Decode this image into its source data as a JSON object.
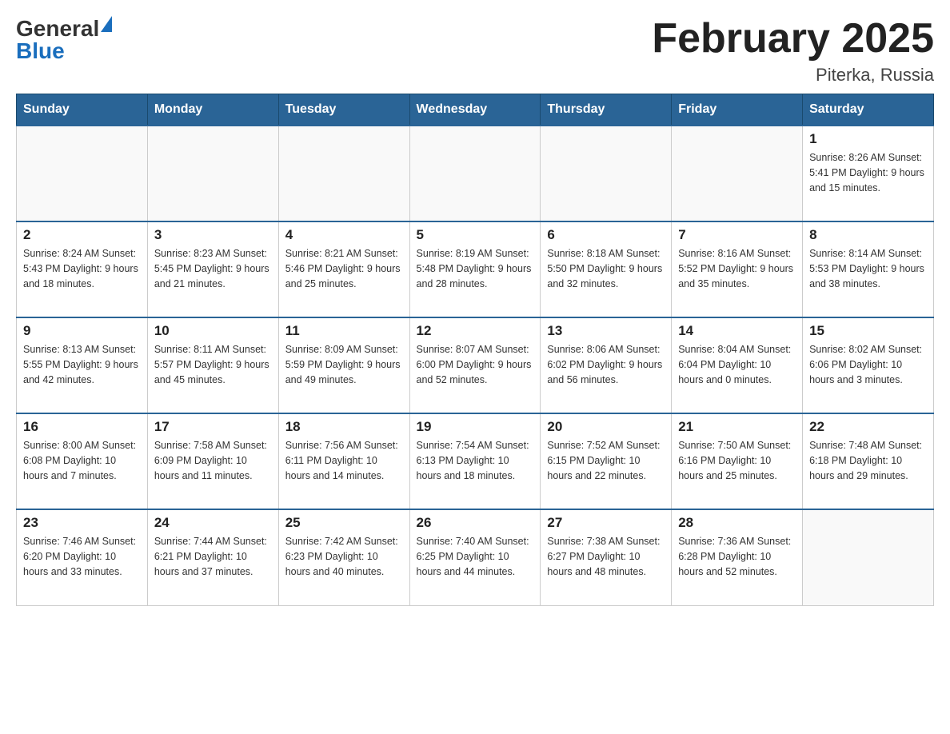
{
  "header": {
    "logo_general": "General",
    "logo_blue": "Blue",
    "month_title": "February 2025",
    "location": "Piterka, Russia"
  },
  "weekdays": [
    "Sunday",
    "Monday",
    "Tuesday",
    "Wednesday",
    "Thursday",
    "Friday",
    "Saturday"
  ],
  "weeks": [
    [
      {
        "day": "",
        "info": ""
      },
      {
        "day": "",
        "info": ""
      },
      {
        "day": "",
        "info": ""
      },
      {
        "day": "",
        "info": ""
      },
      {
        "day": "",
        "info": ""
      },
      {
        "day": "",
        "info": ""
      },
      {
        "day": "1",
        "info": "Sunrise: 8:26 AM\nSunset: 5:41 PM\nDaylight: 9 hours and 15 minutes."
      }
    ],
    [
      {
        "day": "2",
        "info": "Sunrise: 8:24 AM\nSunset: 5:43 PM\nDaylight: 9 hours and 18 minutes."
      },
      {
        "day": "3",
        "info": "Sunrise: 8:23 AM\nSunset: 5:45 PM\nDaylight: 9 hours and 21 minutes."
      },
      {
        "day": "4",
        "info": "Sunrise: 8:21 AM\nSunset: 5:46 PM\nDaylight: 9 hours and 25 minutes."
      },
      {
        "day": "5",
        "info": "Sunrise: 8:19 AM\nSunset: 5:48 PM\nDaylight: 9 hours and 28 minutes."
      },
      {
        "day": "6",
        "info": "Sunrise: 8:18 AM\nSunset: 5:50 PM\nDaylight: 9 hours and 32 minutes."
      },
      {
        "day": "7",
        "info": "Sunrise: 8:16 AM\nSunset: 5:52 PM\nDaylight: 9 hours and 35 minutes."
      },
      {
        "day": "8",
        "info": "Sunrise: 8:14 AM\nSunset: 5:53 PM\nDaylight: 9 hours and 38 minutes."
      }
    ],
    [
      {
        "day": "9",
        "info": "Sunrise: 8:13 AM\nSunset: 5:55 PM\nDaylight: 9 hours and 42 minutes."
      },
      {
        "day": "10",
        "info": "Sunrise: 8:11 AM\nSunset: 5:57 PM\nDaylight: 9 hours and 45 minutes."
      },
      {
        "day": "11",
        "info": "Sunrise: 8:09 AM\nSunset: 5:59 PM\nDaylight: 9 hours and 49 minutes."
      },
      {
        "day": "12",
        "info": "Sunrise: 8:07 AM\nSunset: 6:00 PM\nDaylight: 9 hours and 52 minutes."
      },
      {
        "day": "13",
        "info": "Sunrise: 8:06 AM\nSunset: 6:02 PM\nDaylight: 9 hours and 56 minutes."
      },
      {
        "day": "14",
        "info": "Sunrise: 8:04 AM\nSunset: 6:04 PM\nDaylight: 10 hours and 0 minutes."
      },
      {
        "day": "15",
        "info": "Sunrise: 8:02 AM\nSunset: 6:06 PM\nDaylight: 10 hours and 3 minutes."
      }
    ],
    [
      {
        "day": "16",
        "info": "Sunrise: 8:00 AM\nSunset: 6:08 PM\nDaylight: 10 hours and 7 minutes."
      },
      {
        "day": "17",
        "info": "Sunrise: 7:58 AM\nSunset: 6:09 PM\nDaylight: 10 hours and 11 minutes."
      },
      {
        "day": "18",
        "info": "Sunrise: 7:56 AM\nSunset: 6:11 PM\nDaylight: 10 hours and 14 minutes."
      },
      {
        "day": "19",
        "info": "Sunrise: 7:54 AM\nSunset: 6:13 PM\nDaylight: 10 hours and 18 minutes."
      },
      {
        "day": "20",
        "info": "Sunrise: 7:52 AM\nSunset: 6:15 PM\nDaylight: 10 hours and 22 minutes."
      },
      {
        "day": "21",
        "info": "Sunrise: 7:50 AM\nSunset: 6:16 PM\nDaylight: 10 hours and 25 minutes."
      },
      {
        "day": "22",
        "info": "Sunrise: 7:48 AM\nSunset: 6:18 PM\nDaylight: 10 hours and 29 minutes."
      }
    ],
    [
      {
        "day": "23",
        "info": "Sunrise: 7:46 AM\nSunset: 6:20 PM\nDaylight: 10 hours and 33 minutes."
      },
      {
        "day": "24",
        "info": "Sunrise: 7:44 AM\nSunset: 6:21 PM\nDaylight: 10 hours and 37 minutes."
      },
      {
        "day": "25",
        "info": "Sunrise: 7:42 AM\nSunset: 6:23 PM\nDaylight: 10 hours and 40 minutes."
      },
      {
        "day": "26",
        "info": "Sunrise: 7:40 AM\nSunset: 6:25 PM\nDaylight: 10 hours and 44 minutes."
      },
      {
        "day": "27",
        "info": "Sunrise: 7:38 AM\nSunset: 6:27 PM\nDaylight: 10 hours and 48 minutes."
      },
      {
        "day": "28",
        "info": "Sunrise: 7:36 AM\nSunset: 6:28 PM\nDaylight: 10 hours and 52 minutes."
      },
      {
        "day": "",
        "info": ""
      }
    ]
  ]
}
